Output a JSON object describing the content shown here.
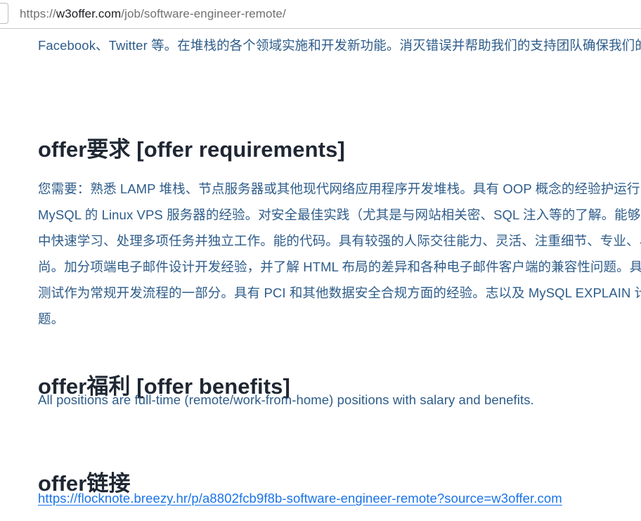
{
  "browser": {
    "url_display": "https://w3offer.com/job/software-engineer-remote/",
    "url_scheme": "https://",
    "url_host": "w3offer.com",
    "url_path": "/job/software-engineer-remote/",
    "back_button_icon": "back-button-partial"
  },
  "page": {
    "intro_paragraph": "Facebook、Twitter 等。在堆栈的各个领域实施和开发新功能。消灭错误并帮助我们的支持团队确保我们的后端设计和编码标准。",
    "sections": [
      {
        "id": "requirements",
        "heading_zh": "offer要求",
        "heading_en": "[offer requirements]",
        "heading_full": "offer要求 [offer requirements]",
        "body": "您需要：熟悉 LAMP 堆栈、节点服务器或其他现代网络应用程序开发堆栈。具有 OOP 概念的经验护运行 Apache、PHP 和 MySQL 的 Linux VPS 服务器的经验。对安全最佳实践（尤其是与网站相关密、SQL 注入等的了解。能够在快速发展和动态的环境中快速学习、处理多项任务并独立工作。能的代码。具有较强的人际交往能力、灵活、注重细节、专业、易于相处、热情且品德高尚。加分项端电子邮件设计开发经验，并了解 HTML 布局的差异和各种电子邮件客户端的兼容性问题。具有队验，并将集成和单元测试作为常规开发流程的一部分。具有 PCI 和其他数据安全合规方面的经验。志以及 MySQL EXPLAIN 计划调试性能或稳定性问题。"
      },
      {
        "id": "benefits",
        "heading_zh": "offer福利",
        "heading_en": "[offer benefits]",
        "heading_full": "offer福利 [offer benefits]",
        "body": "All positions are full-time (remote/work-from-home) positions with salary and benefits."
      },
      {
        "id": "link",
        "heading_zh": "offer链接",
        "heading_en": "",
        "heading_full": "offer链接",
        "link_text": "https://flocknote.breezy.hr/p/a8802fcb9f8b-software-engineer-remote?source=w3offer.com"
      }
    ]
  },
  "colors": {
    "heading": "#1f2733",
    "body_text": "#2e5c8a",
    "link": "#1a73e8",
    "url_bar_text": "#707070",
    "url_bar_host": "#202124",
    "page_background": "#ffffff",
    "chrome_border": "#c8c8c8"
  }
}
